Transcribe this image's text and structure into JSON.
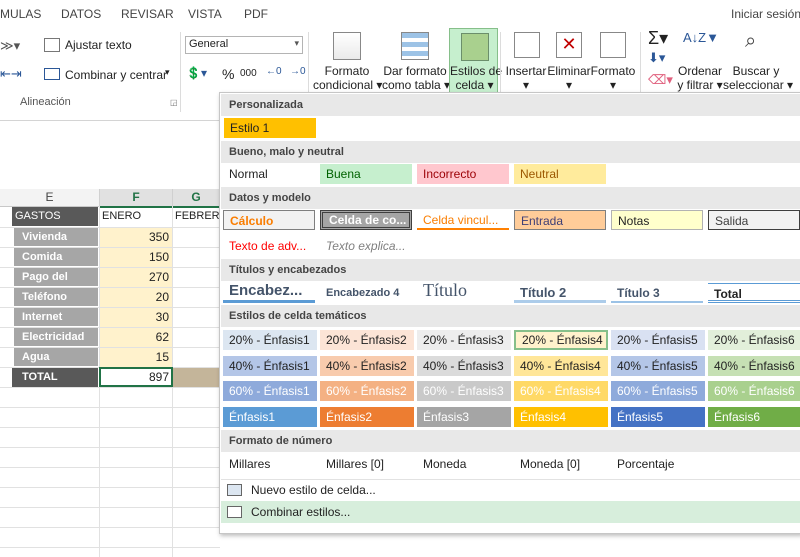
{
  "tabs": [
    "MULAS",
    "DATOS",
    "REVISAR",
    "VISTA",
    "PDF"
  ],
  "signin": "Iniciar sesión",
  "ribbon": {
    "wrap_text": "Ajustar texto",
    "merge_center": "Combinar y centrar",
    "alignment_group": "Alineación",
    "number_format": "General",
    "percent": "%",
    "thousands": "000",
    "cond_format": [
      "Formato",
      "condicional ▾"
    ],
    "format_table": [
      "Dar formato",
      "como tabla ▾"
    ],
    "cell_styles": [
      "Estilos de",
      "celda ▾"
    ],
    "insert": "Insertar",
    "delete": "Eliminar",
    "format": "Formato",
    "sort_filter": [
      "Ordenar",
      "y filtrar ▾"
    ],
    "find_select": [
      "Buscar y",
      "seleccionar ▾"
    ]
  },
  "sheet": {
    "col_headers": [
      "E",
      "F",
      "G"
    ],
    "header_row": {
      "label": "GASTOS",
      "f": "ENERO",
      "g": "FEBRERO"
    },
    "rows": [
      {
        "label": "Vivienda",
        "value": "350"
      },
      {
        "label": "Comida",
        "value": "150"
      },
      {
        "label": "Pago del coche",
        "value": "270"
      },
      {
        "label": "Teléfono móvil",
        "value": "20"
      },
      {
        "label": "Internet",
        "value": "30"
      },
      {
        "label": "Electricidad",
        "value": "62"
      },
      {
        "label": "Agua",
        "value": "15"
      }
    ],
    "total_label": "TOTAL",
    "total_value": "897"
  },
  "gallery": {
    "sections": {
      "custom": "Personalizada",
      "good_bad": "Bueno, malo y neutral",
      "data_model": "Datos y modelo",
      "titles": "Títulos y encabezados",
      "themed": "Estilos de celda temáticos",
      "number": "Formato de número"
    },
    "custom_styles": [
      "Estilo 1"
    ],
    "good_bad": [
      "Normal",
      "Buena",
      "Incorrecto",
      "Neutral"
    ],
    "data_model_row1": [
      "Cálculo",
      "Celda de co...",
      "Celda vincul...",
      "Entrada",
      "Notas",
      "Salida"
    ],
    "data_model_row2": [
      "Texto de adv...",
      "Texto explica..."
    ],
    "titles": [
      "Encabez...",
      "Encabezado 4",
      "Título",
      "Título 2",
      "Título 3",
      "Total"
    ],
    "themed_20": [
      "20% - Énfasis1",
      "20% - Énfasis2",
      "20% - Énfasis3",
      "20% - Énfasis4",
      "20% - Énfasis5",
      "20% - Énfasis6"
    ],
    "themed_40": [
      "40% - Énfasis1",
      "40% - Énfasis2",
      "40% - Énfasis3",
      "40% - Énfasis4",
      "40% - Énfasis5",
      "40% - Énfasis6"
    ],
    "themed_60": [
      "60% - Énfasis1",
      "60% - Énfasis2",
      "60% - Énfasis3",
      "60% - Énfasis4",
      "60% - Énfasis5",
      "60% - Énfasis6"
    ],
    "themed_100": [
      "Énfasis1",
      "Énfasis2",
      "Énfasis3",
      "Énfasis4",
      "Énfasis5",
      "Énfasis6"
    ],
    "number_formats": [
      "Millares",
      "Millares [0]",
      "Moneda",
      "Moneda [0]",
      "Porcentaje"
    ],
    "new_style": "Nuevo estilo de celda...",
    "merge_styles": "Combinar estilos..."
  },
  "colors": {
    "accent1_20": "#dce6f1",
    "accent2_20": "#fce4d6",
    "accent3_20": "#ededed",
    "accent4_20": "#fff2cc",
    "accent5_20": "#d9e1f2",
    "accent6_20": "#e2efda",
    "accent1_40": "#b4c6e7",
    "accent2_40": "#f8cbad",
    "accent3_40": "#dbdbdb",
    "accent4_40": "#ffe699",
    "accent5_40": "#b4c6e7",
    "accent6_40": "#c6e0b4",
    "accent1_60": "#8eaadb",
    "accent2_60": "#f4b183",
    "accent3_60": "#c9c9c9",
    "accent4_60": "#ffd966",
    "accent5_60": "#8eaadb",
    "accent6_60": "#a9d08e",
    "accent1": "#5b9bd5",
    "accent2": "#ed7d31",
    "accent3": "#a5a5a5",
    "accent4": "#ffc000",
    "accent5": "#4472c4",
    "accent6": "#70ad47"
  }
}
